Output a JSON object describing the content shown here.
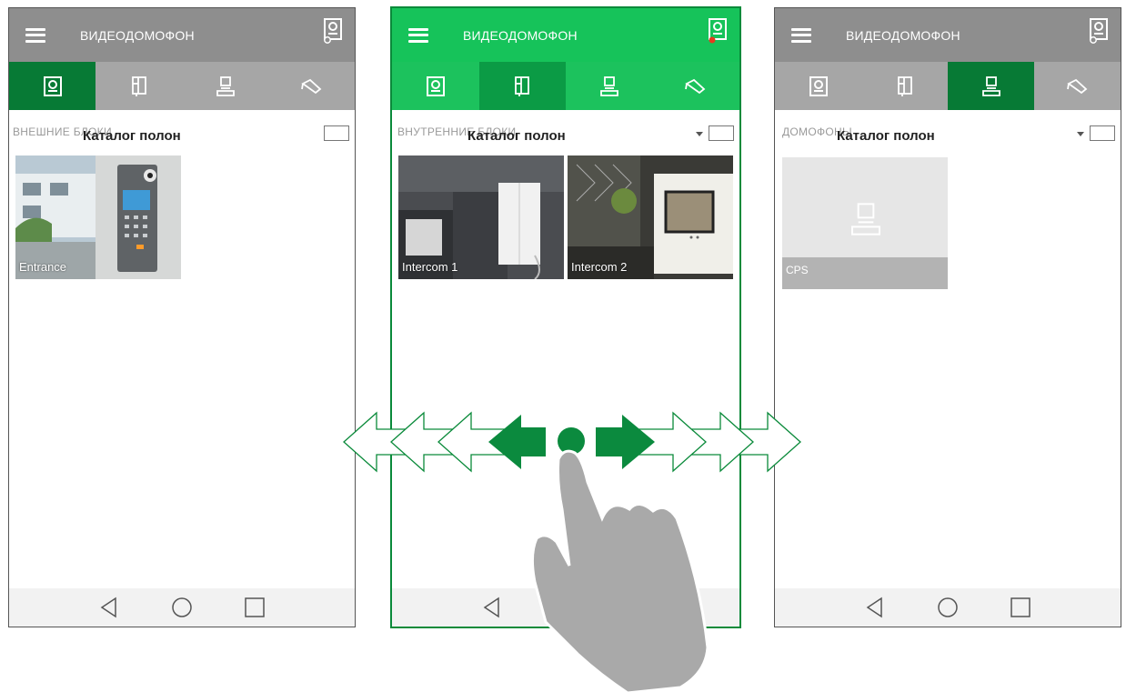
{
  "app_title": "ВИДЕОДОМОФОН",
  "catalog_label": "Каталог полон",
  "colors": {
    "green": "#0b9b45",
    "green_dark": "#077a35",
    "green_light": "#16c35a",
    "grey_bar": "#8e8e8e",
    "grey_tabs": "#a6a6a6",
    "indicator_red": "#e53a1f"
  },
  "screens": [
    {
      "section": "ВНЕШНИЕ БЛОКИ",
      "active_tab": 0,
      "items": [
        {
          "label": "Entrance"
        }
      ]
    },
    {
      "section": "ВНУТРЕННИЕ БЛОКИ",
      "active_tab": 1,
      "items": [
        {
          "label": "Intercom 1"
        },
        {
          "label": "Intercom 2"
        }
      ]
    },
    {
      "section": "ДОМОФОНЫ",
      "active_tab": 2,
      "items": [
        {
          "label": "CPS"
        }
      ]
    }
  ],
  "tabs": [
    "door-unit-icon",
    "handset-icon",
    "concierge-icon",
    "camera-icon"
  ],
  "nav": [
    "back-icon",
    "home-icon",
    "recents-icon"
  ]
}
